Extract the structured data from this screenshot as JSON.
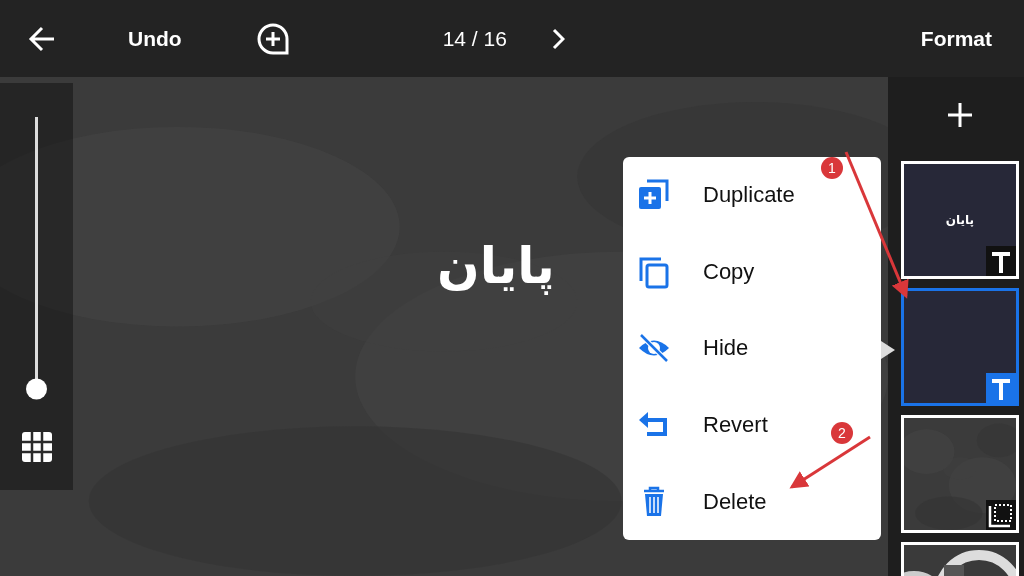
{
  "toolbar": {
    "undo_label": "Undo",
    "page_indicator": "14 / 16",
    "format_label": "Format"
  },
  "left_panel": {
    "zoom_slider": {
      "level": 0
    }
  },
  "slide": {
    "text": "پایان"
  },
  "slides_panel": {
    "thumbnails": [
      {
        "kind": "text",
        "text": "پایان",
        "selected": false
      },
      {
        "kind": "text",
        "selected": true
      },
      {
        "kind": "picture",
        "selected": false
      },
      {
        "kind": "pattern",
        "selected": false
      }
    ]
  },
  "context_menu": {
    "items": [
      {
        "kind": "duplicate",
        "label": "Duplicate"
      },
      {
        "kind": "copy",
        "label": "Copy"
      },
      {
        "kind": "hide",
        "label": "Hide"
      },
      {
        "kind": "revert",
        "label": "Revert"
      },
      {
        "kind": "delete",
        "label": "Delete"
      }
    ]
  },
  "annotations": [
    {
      "number": "1"
    },
    {
      "number": "2"
    }
  ]
}
